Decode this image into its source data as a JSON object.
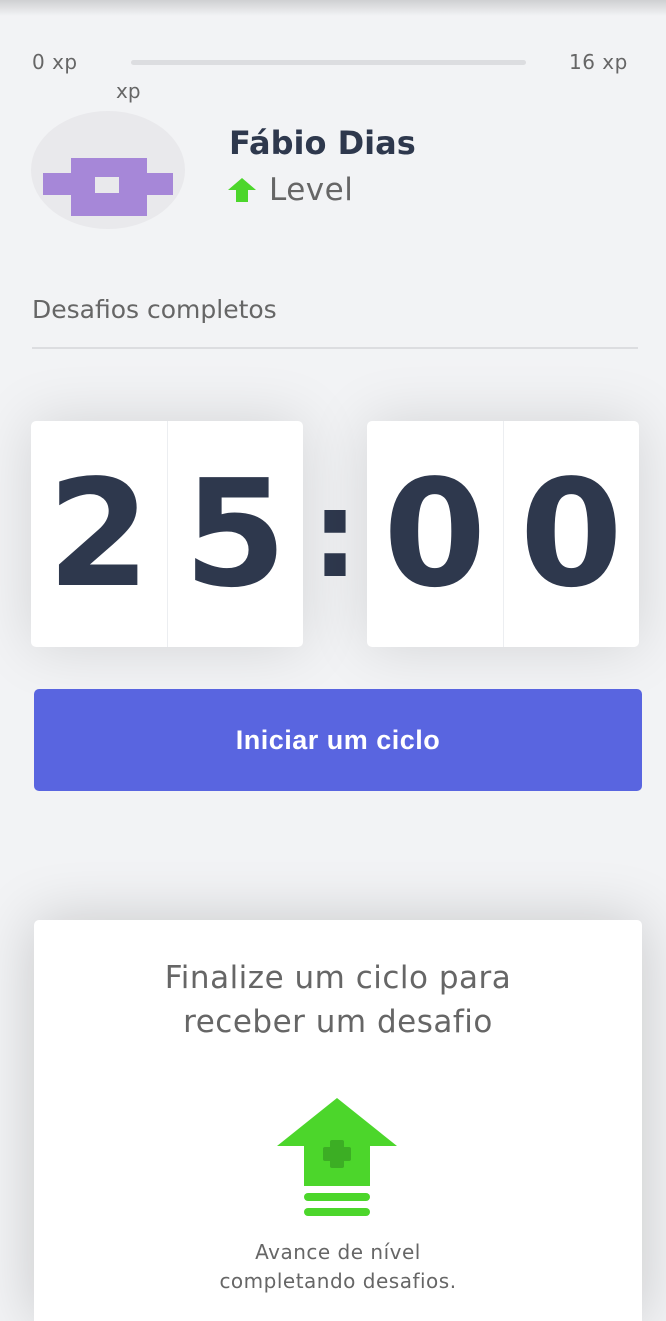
{
  "xp_bar": {
    "start_label": "0 xp",
    "end_label": "16 xp",
    "current_label": "xp",
    "progress_fraction": 0
  },
  "profile": {
    "name": "Fábio Dias",
    "level_label": "Level",
    "avatar_icon": "pixel-avatar-icon",
    "avatar_color": "#a687d8",
    "level_icon": "level-up-arrow-icon"
  },
  "completed_challenges": {
    "label": "Desafios completos"
  },
  "countdown": {
    "minutes": [
      "2",
      "5"
    ],
    "separator": ":",
    "seconds": [
      "0",
      "0"
    ]
  },
  "start_button": {
    "label": "Iniciar um ciclo"
  },
  "challenge_card": {
    "title_lines": [
      "Finalize um ciclo para",
      "receber um desafio"
    ],
    "icon": "level-up-icon",
    "text_lines": [
      "Avance de nível",
      "completando desafios."
    ]
  },
  "colors": {
    "accent_blue": "#5965e0",
    "green": "#4cd62b",
    "title_dark": "#2e384d",
    "text_gray": "#666666",
    "background": "#f2f3f5"
  }
}
